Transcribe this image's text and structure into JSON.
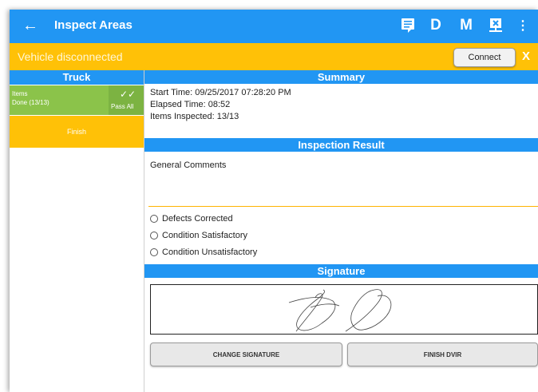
{
  "header": {
    "title": "Inspect Areas",
    "back_icon": "←",
    "d_label": "D",
    "m_label": "M",
    "more_icon": "⋮"
  },
  "banner": {
    "message": "Vehicle disconnected",
    "connect_label": "Connect",
    "close_label": "X"
  },
  "left_panel": {
    "header": "Truck",
    "items": {
      "label": "Items",
      "status": "Done (13/13)",
      "pass_all_icon": "✓✓",
      "pass_all_label": "Pass All"
    },
    "finish_label": "Finish"
  },
  "summary": {
    "header": "Summary",
    "start_time": "Start Time: 09/25/2017 07:28:20 PM",
    "elapsed_time": "Elapsed Time: 08:52",
    "items_inspected": "Items Inspected: 13/13"
  },
  "inspection_result": {
    "header": "Inspection Result",
    "comments_label": "General Comments",
    "options": [
      "Defects Corrected",
      "Condition Satisfactory",
      "Condition Unsatisfactory"
    ]
  },
  "signature": {
    "header": "Signature",
    "change_label": "CHANGE SIGNATURE",
    "finish_label": "FINISH DVIR"
  },
  "colors": {
    "primary": "#2196F3",
    "warning": "#FFC107",
    "success": "#8BC34A"
  }
}
